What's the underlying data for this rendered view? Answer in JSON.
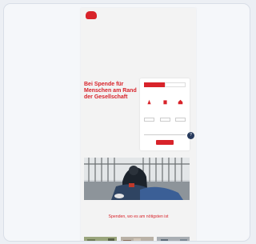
{
  "colors": {
    "brand_red": "#d8232a",
    "help_bubble": "#263a5c"
  },
  "header": {
    "logo_text": "",
    "nav": [
      "",
      "",
      ""
    ]
  },
  "hero": {
    "title": "Bei Spende für Menschen am Rand der Gesellschaft"
  },
  "donation_form": {
    "tabs": [
      "",
      ""
    ],
    "frequency": [
      "",
      ""
    ],
    "amounts": [
      "",
      "",
      ""
    ],
    "custom_placeholder": "",
    "submit_label": ""
  },
  "help_icon": "question-icon",
  "section": {
    "title": "Spenden, wo es am nötigsten ist"
  }
}
